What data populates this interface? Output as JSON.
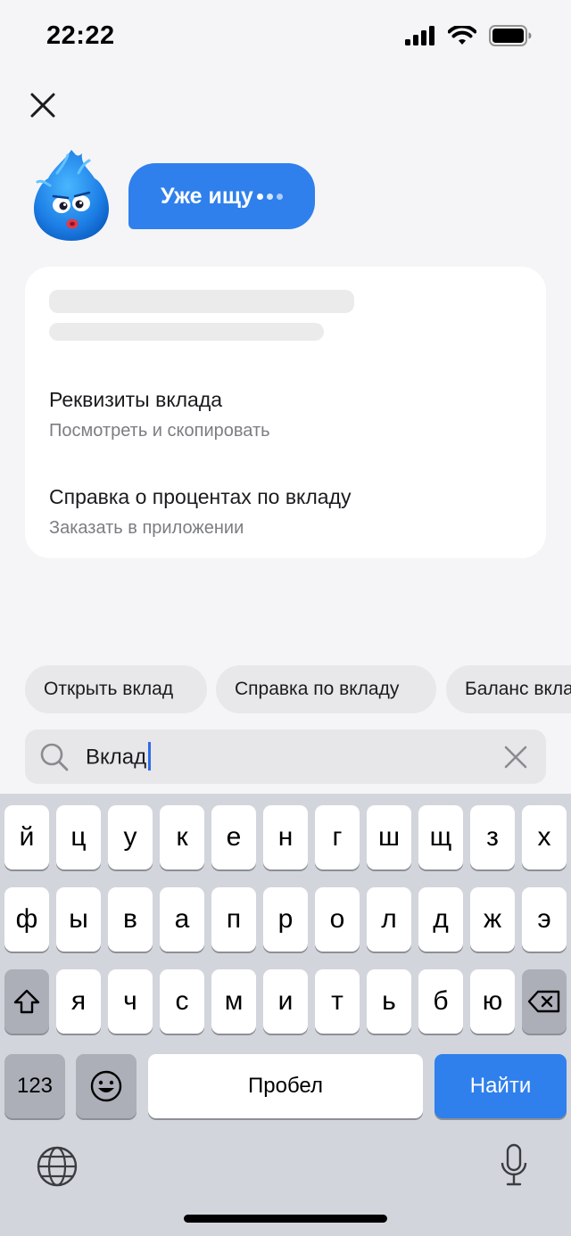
{
  "status_bar": {
    "time": "22:22"
  },
  "assistant": {
    "bubble_text": "Уже ищу"
  },
  "results": [
    {
      "title": "Реквизиты вклада",
      "subtitle": "Посмотреть и скопировать"
    },
    {
      "title": "Справка о процентах по вкладу",
      "subtitle": "Заказать в приложении"
    }
  ],
  "suggestions": [
    "Открыть вклад",
    "Справка по вкладу",
    "Баланс вклада"
  ],
  "search": {
    "value": "Вклад"
  },
  "keyboard": {
    "row1": [
      "й",
      "ц",
      "у",
      "к",
      "е",
      "н",
      "г",
      "ш",
      "щ",
      "з",
      "х"
    ],
    "row2": [
      "ф",
      "ы",
      "в",
      "а",
      "п",
      "р",
      "о",
      "л",
      "д",
      "ж",
      "э"
    ],
    "row3": [
      "я",
      "ч",
      "с",
      "м",
      "и",
      "т",
      "ь",
      "б",
      "ю"
    ],
    "numbers_label": "123",
    "space_label": "Пробел",
    "action_label": "Найти"
  }
}
